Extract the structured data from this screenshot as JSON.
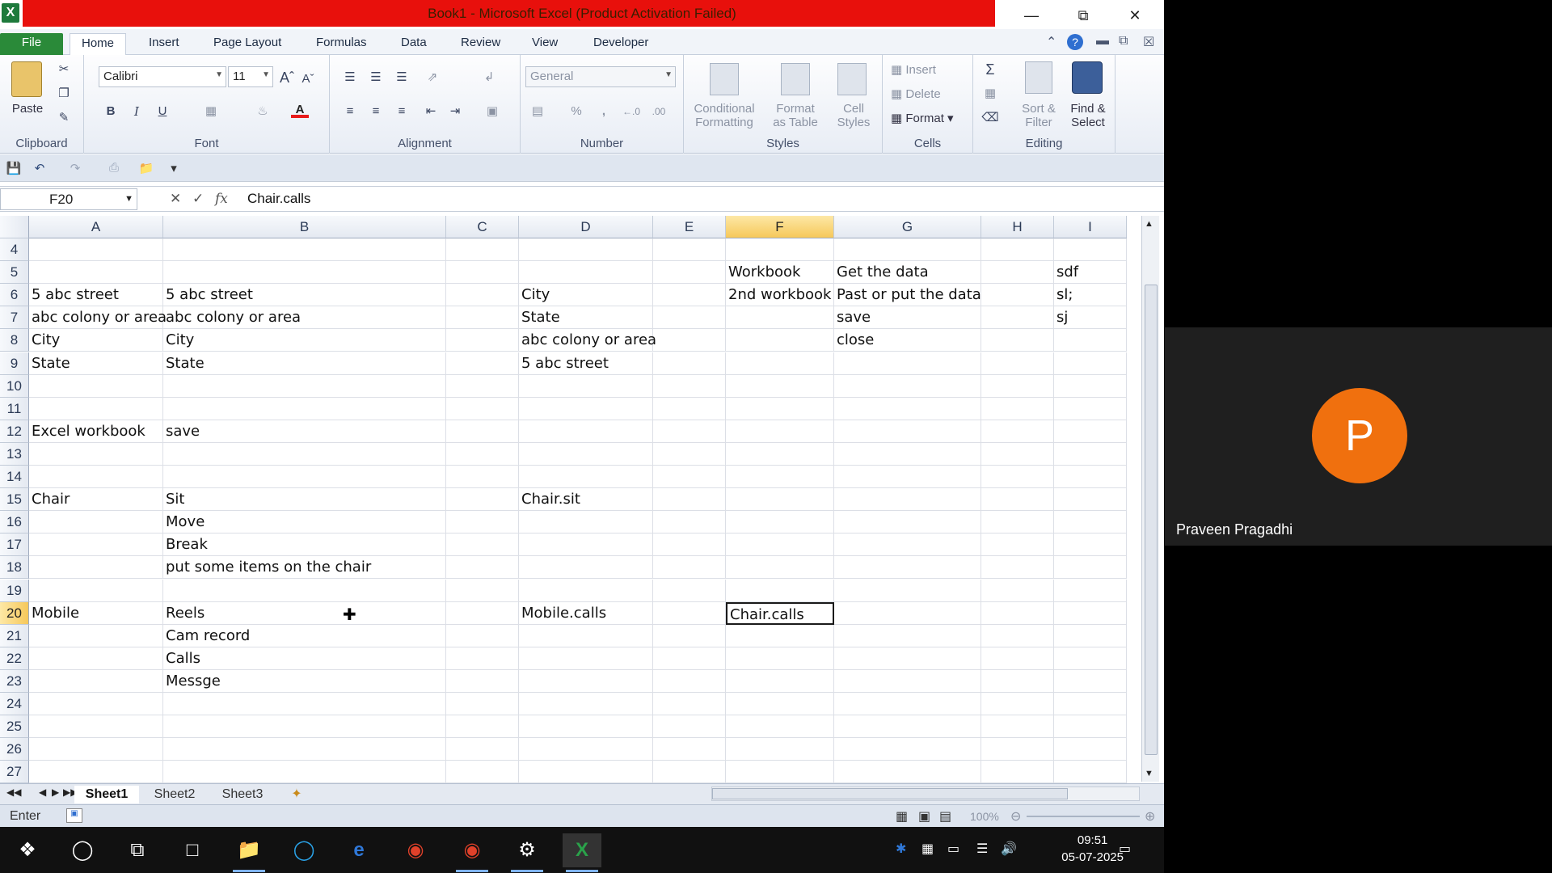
{
  "window": {
    "title": "Book1 - Microsoft Excel (Product Activation Failed)",
    "app_icon": "X"
  },
  "menu": {
    "file": "File",
    "tabs": [
      "Home",
      "Insert",
      "Page Layout",
      "Formulas",
      "Data",
      "Review",
      "View",
      "Developer"
    ]
  },
  "ribbon": {
    "clipboard": {
      "label": "Clipboard",
      "paste": "Paste"
    },
    "font": {
      "label": "Font",
      "name": "Calibri",
      "size": "11",
      "bold": "B",
      "italic": "I",
      "underline": "U"
    },
    "alignment": {
      "label": "Alignment"
    },
    "number": {
      "label": "Number",
      "format": "General",
      "percent": "%",
      "comma": ","
    },
    "styles": {
      "label": "Styles",
      "conditional": "Conditional",
      "conditional2": "Formatting",
      "format_table": "Format",
      "format_table2": "as Table",
      "cell_styles": "Cell",
      "cell_styles2": "Styles"
    },
    "cells": {
      "label": "Cells",
      "insert": "Insert",
      "delete": "Delete",
      "format": "Format"
    },
    "editing": {
      "label": "Editing",
      "sort": "Sort &",
      "sort2": "Filter",
      "find": "Find &",
      "find2": "Select"
    }
  },
  "formula_bar": {
    "name_box": "F20",
    "fx": "fx",
    "content": "Chair.calls"
  },
  "columns": [
    "A",
    "B",
    "C",
    "D",
    "E",
    "F",
    "G",
    "H",
    "I"
  ],
  "rows": [
    "4",
    "5",
    "6",
    "7",
    "8",
    "9",
    "10",
    "11",
    "12",
    "13",
    "14",
    "15",
    "16",
    "17",
    "18",
    "19",
    "20",
    "21",
    "22",
    "23",
    "24",
    "25",
    "26",
    "27"
  ],
  "cells": {
    "F5": "Workbook",
    "G5": "Get the data",
    "I5": "sdf",
    "A6": "5 abc street",
    "B6": "5 abc street",
    "D6": "City",
    "F6": "2nd workbook",
    "G6": "Past or put the data",
    "I6": "sl;",
    "A7": "abc colony or area",
    "B7": "abc colony or area",
    "D7": "State",
    "G7": "save",
    "I7": "sj",
    "A8": "City",
    "B8": "City",
    "D8": "abc colony or area",
    "G8": "close",
    "A9": "State",
    "B9": "State",
    "D9": "5 abc street",
    "A12": "Excel workbook",
    "B12": "save",
    "A15": "Chair",
    "B15": "Sit",
    "D15": "Chair.sit",
    "B16": "Move",
    "B17": "Break",
    "B18": "put some items on the chair",
    "A20": "Mobile",
    "B20": "Reels",
    "D20": "Mobile.calls",
    "F20": "Chair.calls",
    "B21": "Cam record",
    "B22": "Calls",
    "B23": "Messge"
  },
  "active_cell": "F20",
  "sheets": [
    "Sheet1",
    "Sheet2",
    "Sheet3"
  ],
  "status": {
    "mode": "Enter",
    "zoom": "100%"
  },
  "meeting": {
    "initial": "P",
    "name": "Praveen Pragadhi",
    "avatar_color": "#f0700e"
  },
  "taskbar": {
    "time": "09:51",
    "date": "05-07-2025"
  }
}
